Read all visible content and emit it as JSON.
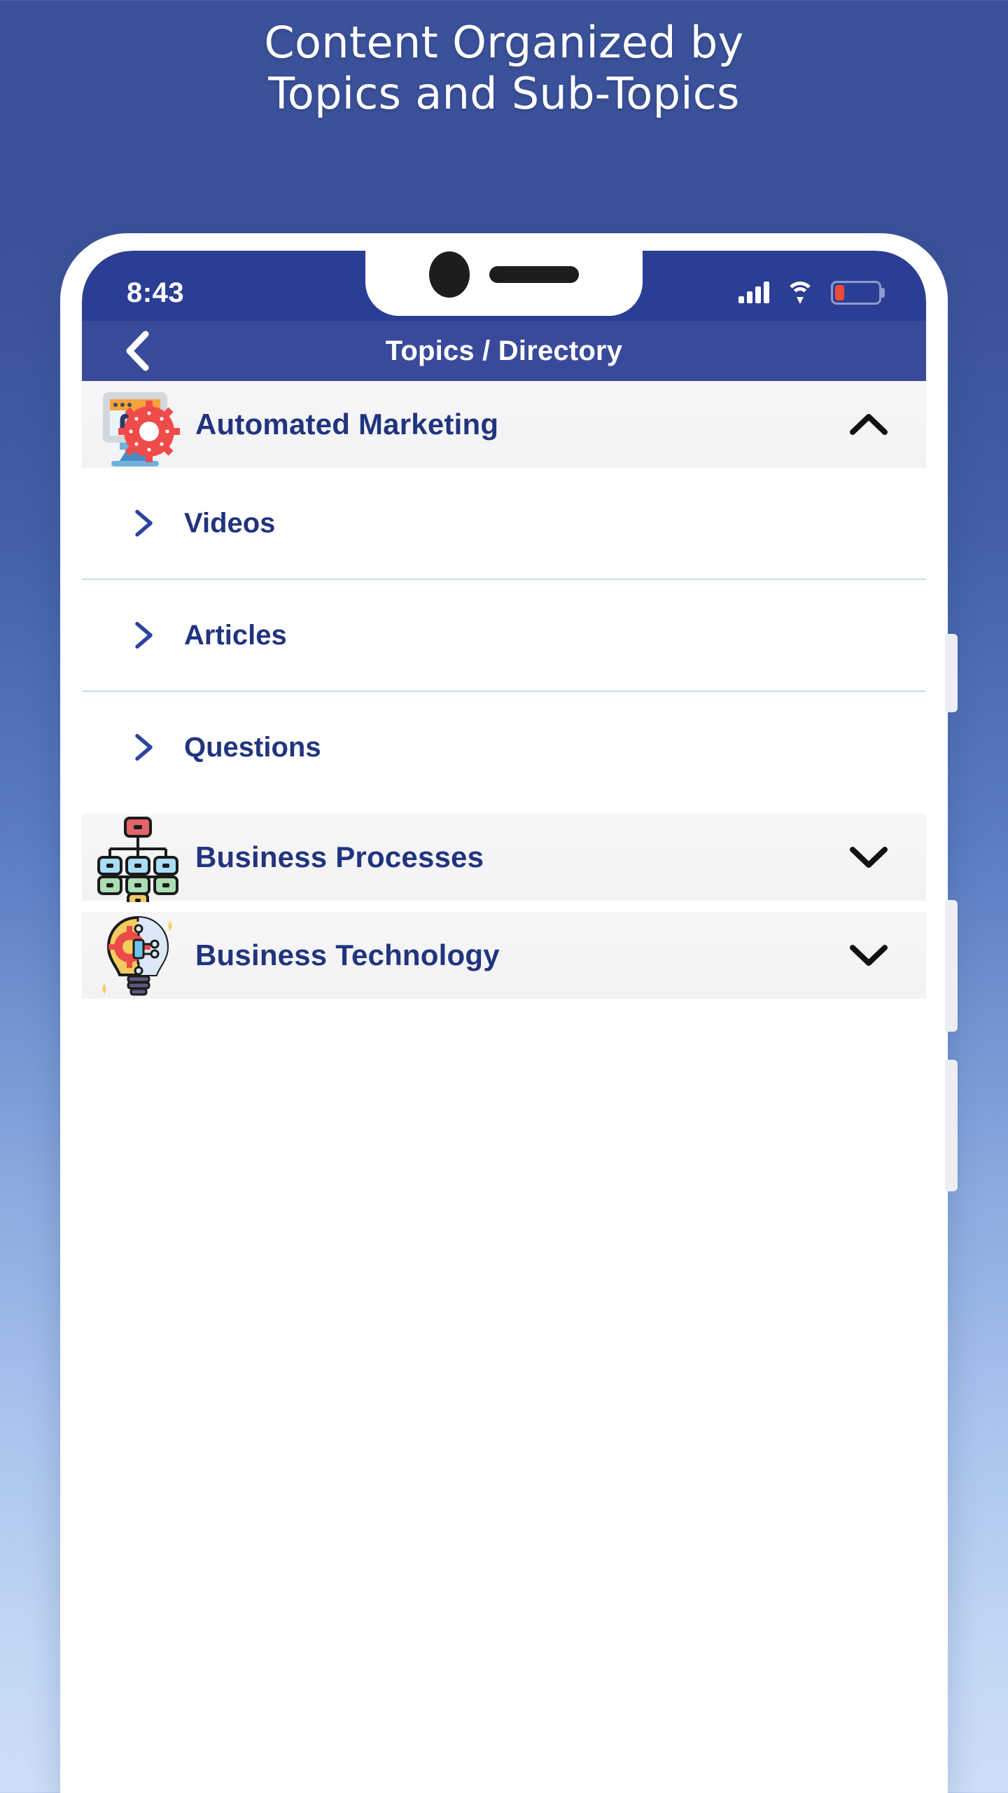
{
  "headline": {
    "line1": "Content Organized by",
    "line2": "Topics and Sub-Topics"
  },
  "phone": {
    "status_bar": {
      "time": "8:43",
      "signal_icon": "cellular-signal-icon",
      "wifi_icon": "wifi-icon",
      "battery_icon": "battery-low-icon",
      "battery_level_percent": 22
    },
    "nav_bar": {
      "back_icon": "chevron-left-icon",
      "title": "Topics / Directory"
    },
    "topics": [
      {
        "label": "Automated Marketing",
        "icon": "automated-marketing-icon",
        "chevron": "chevron-up-icon",
        "expanded": true,
        "subitems": [
          {
            "label": "Videos",
            "chevron": "chevron-right-icon"
          },
          {
            "label": "Articles",
            "chevron": "chevron-right-icon"
          },
          {
            "label": "Questions",
            "chevron": "chevron-right-icon"
          }
        ]
      },
      {
        "label": "Business Processes",
        "icon": "business-processes-icon",
        "chevron": "chevron-down-icon",
        "expanded": false,
        "subitems": []
      },
      {
        "label": "Business Technology",
        "icon": "business-technology-icon",
        "chevron": "chevron-down-icon",
        "expanded": false,
        "subitems": []
      }
    ]
  },
  "colors": {
    "background_top": "#3b5199",
    "background_bottom": "#cfdffa",
    "status_bar": "#2c3e93",
    "nav_bar": "#3a4a9b",
    "text_primary": "#22347e",
    "row_background": "#f4f4f7",
    "battery_low": "#ef4b3a",
    "divider": "#c9d9ea"
  }
}
